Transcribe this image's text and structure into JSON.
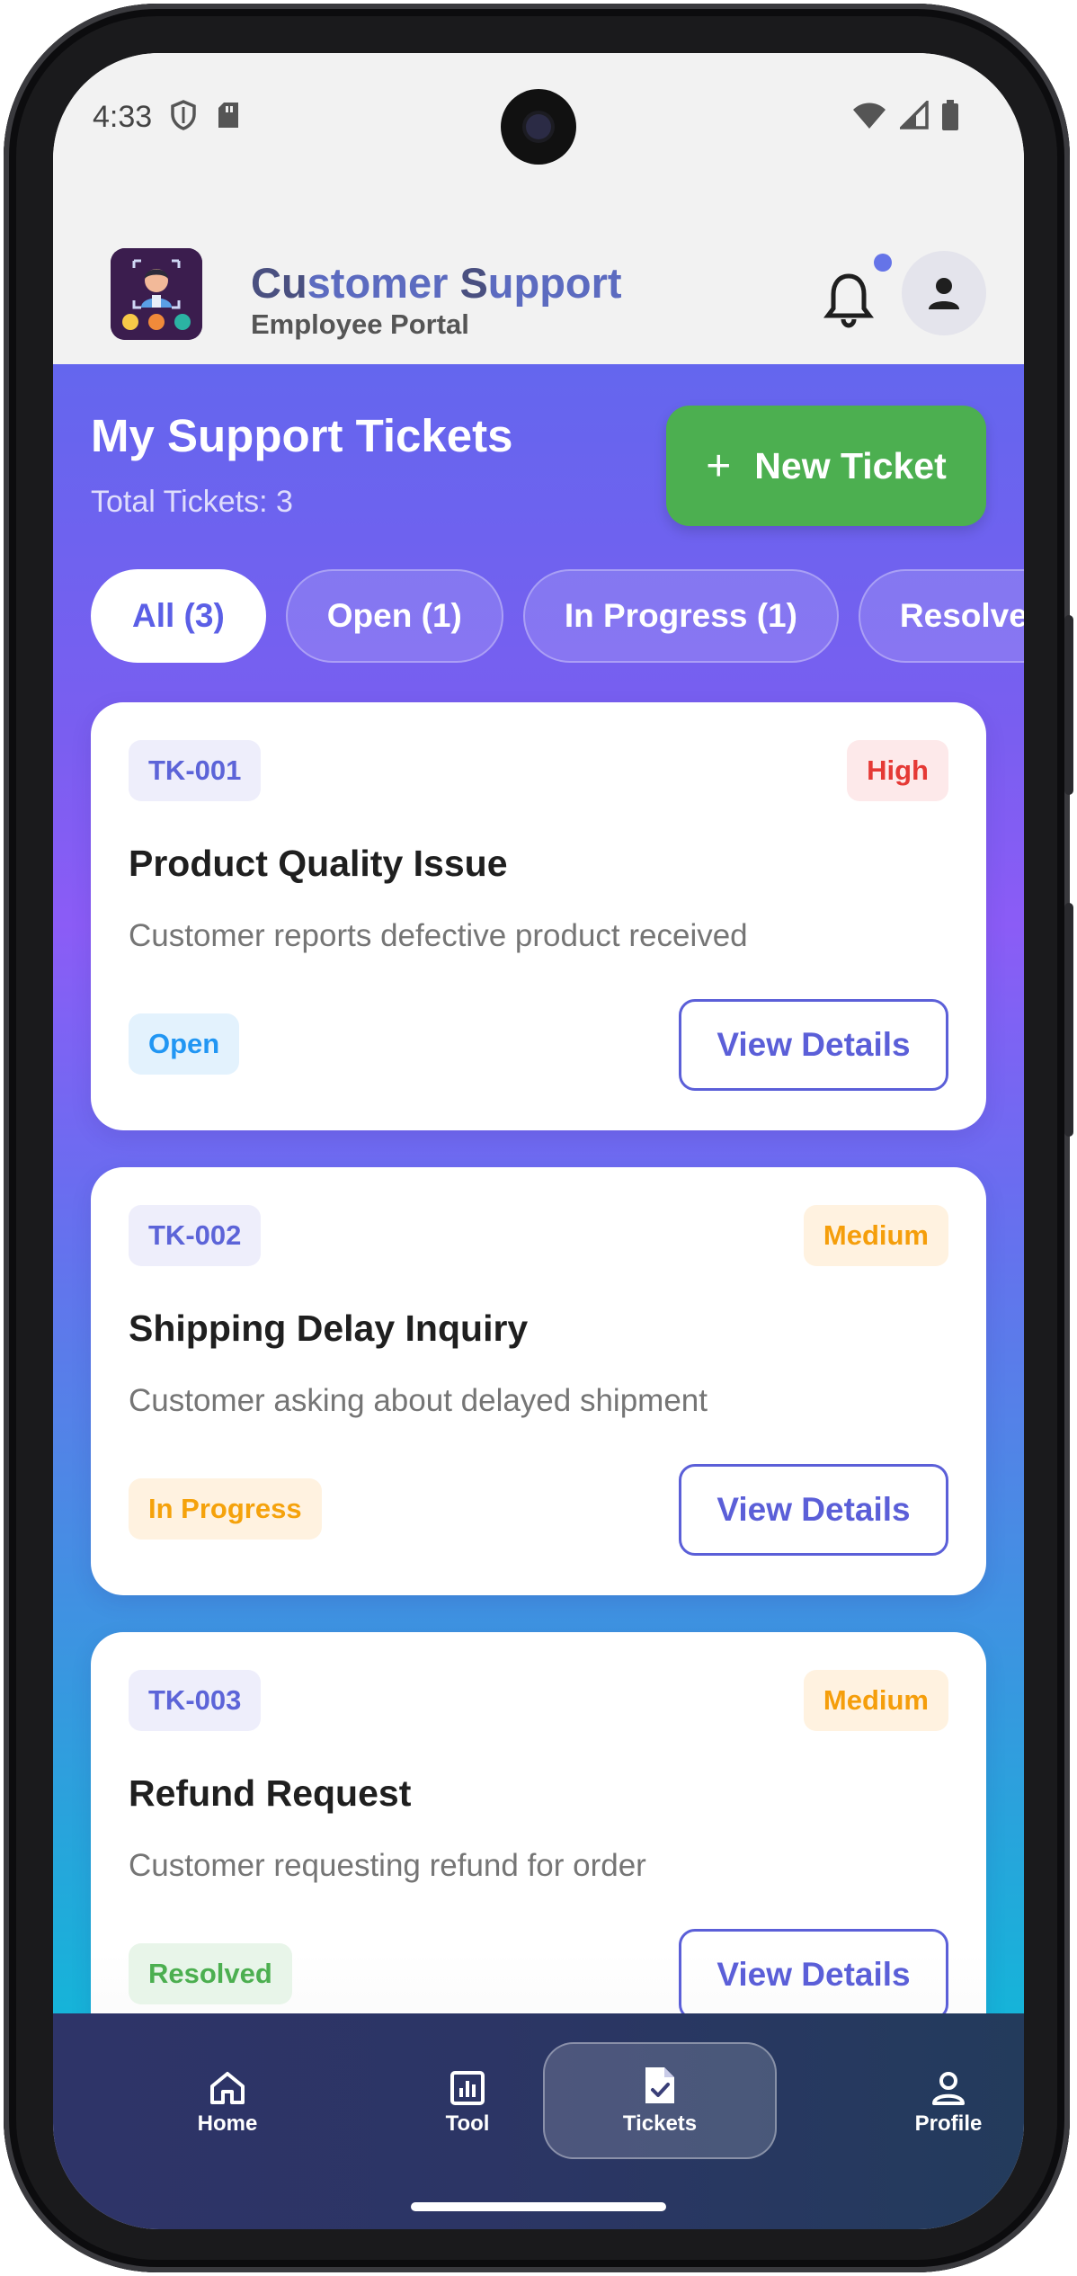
{
  "status_bar": {
    "time": "4:33"
  },
  "app_bar": {
    "title_part1": "Cu",
    "title_accent1": "stomer ",
    "title_part2": "S",
    "title_accent2": "upport",
    "subtitle": "Employee Portal"
  },
  "header": {
    "title": "My Support Tickets",
    "total": "Total Tickets: 3",
    "new_ticket_label": "New Ticket"
  },
  "filters": [
    {
      "label": "All (3)",
      "active": true
    },
    {
      "label": "Open (1)",
      "active": false
    },
    {
      "label": "In Progress (1)",
      "active": false
    },
    {
      "label": "Resolved",
      "active": false
    }
  ],
  "tickets": [
    {
      "id": "TK-001",
      "priority": "High",
      "title": "Product Quality Issue",
      "description": "Customer reports defective product received",
      "status": "Open",
      "action": "View Details"
    },
    {
      "id": "TK-002",
      "priority": "Medium",
      "title": "Shipping Delay Inquiry",
      "description": "Customer asking about delayed shipment",
      "status": "In Progress",
      "action": "View Details"
    },
    {
      "id": "TK-003",
      "priority": "Medium",
      "title": "Refund Request",
      "description": "Customer requesting refund for order",
      "status": "Resolved",
      "action": "View Details"
    }
  ],
  "bottom_nav": [
    {
      "label": "Home",
      "icon": "home-icon"
    },
    {
      "label": "Tool",
      "icon": "chart-icon"
    },
    {
      "label": "Tickets",
      "icon": "ticket-file-icon",
      "active": true
    },
    {
      "label": "Profile",
      "icon": "person-icon"
    }
  ],
  "colors": {
    "accent": "#5b5fe6",
    "new_ticket_green": "#4caf50",
    "priority_high": "#e53935",
    "priority_medium": "#f59e0b",
    "status_open": "#2196f3",
    "status_in_progress": "#f5a20b",
    "status_resolved": "#4caf50"
  }
}
